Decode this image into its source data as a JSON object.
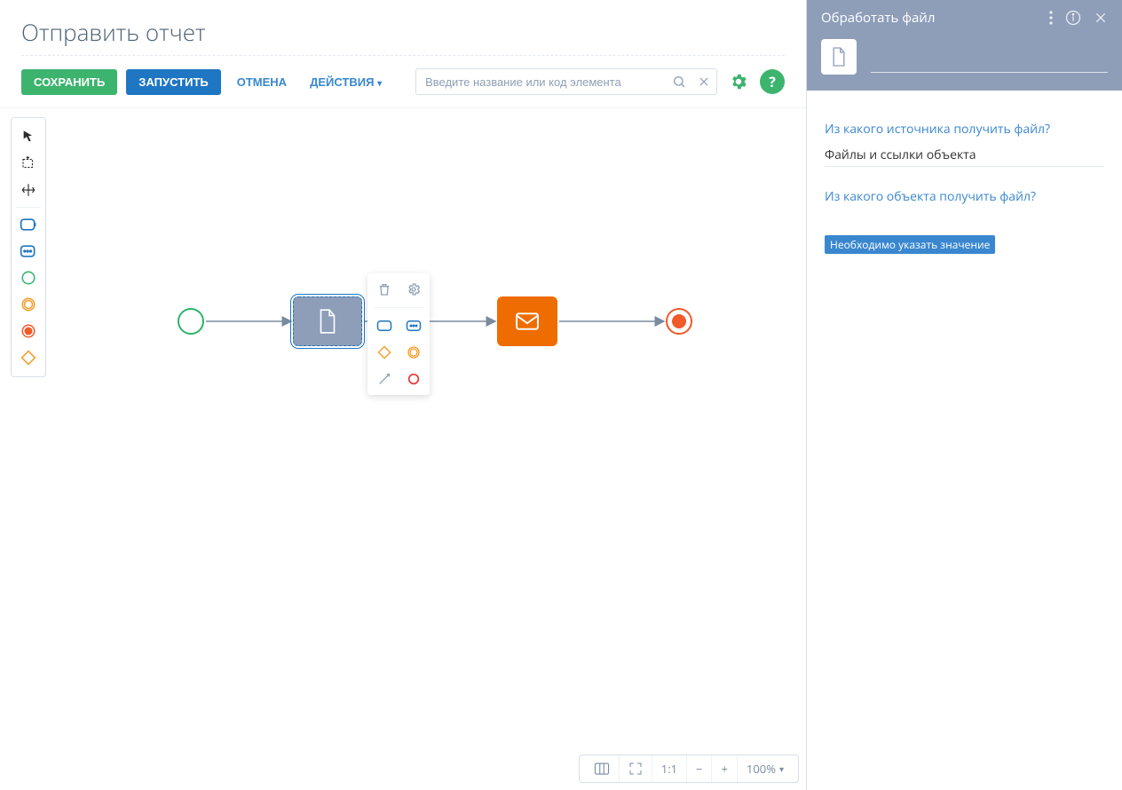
{
  "page": {
    "title": "Отправить отчет"
  },
  "toolbar": {
    "save_label": "СОХРАНИТЬ",
    "run_label": "ЗАПУСТИТЬ",
    "cancel_label": "ОТМЕНА",
    "actions_label": "ДЕЙСТВИЯ",
    "search_placeholder": "Введите название или код элемента"
  },
  "statusbar": {
    "ratio": "1:1",
    "zoom": "100%"
  },
  "panel": {
    "title": "Обработать файл",
    "name_value": "",
    "field1_label": "Из какого источника получить файл?",
    "field1_value": "Файлы и ссылки объекта",
    "field2_label": "Из какого объекта получить файл?",
    "warning": "Необходимо указать значение"
  }
}
